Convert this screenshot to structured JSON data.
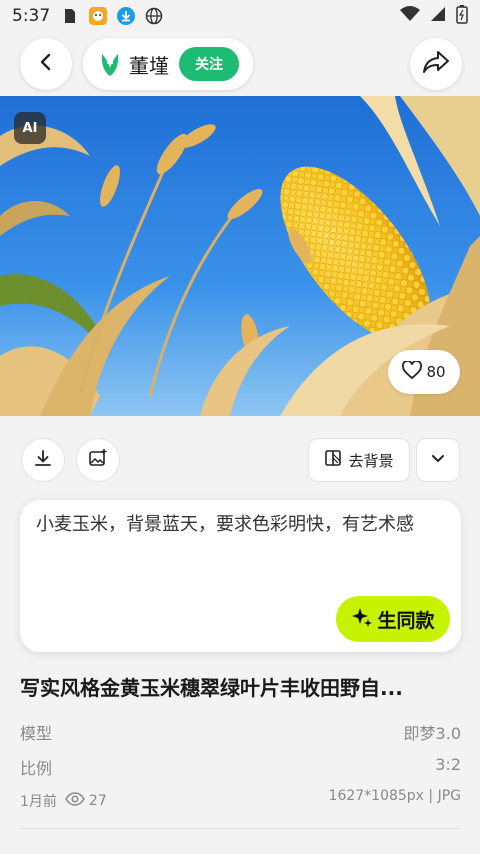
{
  "status_bar": {
    "time": "5:37"
  },
  "header": {
    "author_name": "董墐",
    "follow_label": "关注"
  },
  "hero": {
    "ai_badge": "AI",
    "like_count": "80"
  },
  "actions": {
    "remove_bg_label": "去背景"
  },
  "prompt": {
    "text": "小麦玉米，背景蓝天，要求色彩明快，有艺术感",
    "generate_label": "生同款"
  },
  "details": {
    "title": "写实风格金黄玉米穗翠绿叶片丰收田野自...",
    "model_label": "模型",
    "model_value": "即梦3.0",
    "ratio_label": "比例",
    "ratio_value": "3:2",
    "time_ago": "1月前",
    "views": "27",
    "image_info": "1627*1085px | JPG"
  },
  "colors": {
    "follow_green": "#1ebc72",
    "generate_lime": "#c8f300",
    "sky_blue": "#2a7ce0"
  }
}
